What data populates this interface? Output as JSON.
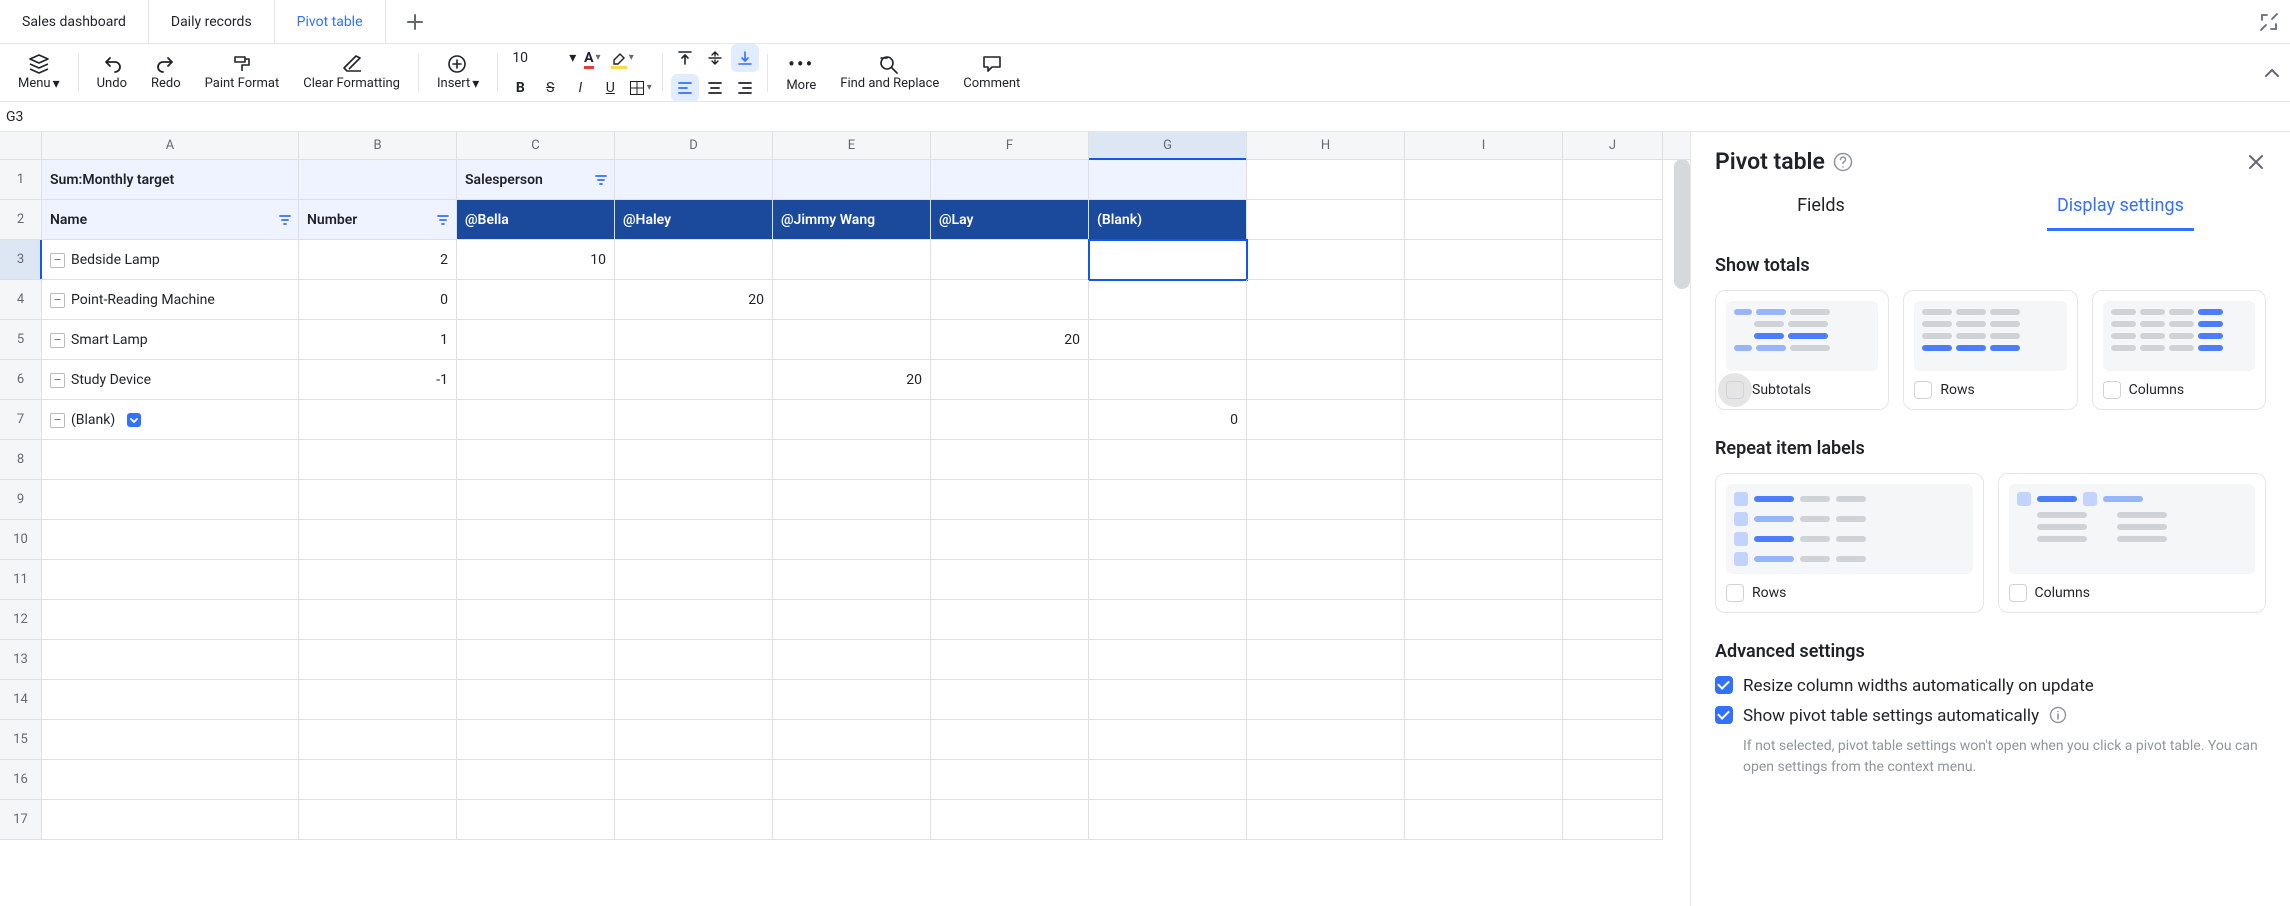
{
  "tabs": {
    "items": [
      {
        "label": "Sales dashboard"
      },
      {
        "label": "Daily records"
      },
      {
        "label": "Pivot table"
      }
    ],
    "activeIndex": 2
  },
  "toolbar": {
    "menu": "Menu",
    "undo": "Undo",
    "redo": "Redo",
    "paint_format": "Paint Format",
    "clear_formatting": "Clear Formatting",
    "insert": "Insert",
    "font_size": "10",
    "more": "More",
    "find_replace": "Find and Replace",
    "comment": "Comment"
  },
  "reference": {
    "cell": "G3"
  },
  "grid": {
    "columns": [
      "A",
      "B",
      "C",
      "D",
      "E",
      "F",
      "G",
      "H",
      "I",
      "J"
    ],
    "active_column": "G",
    "row_numbers": [
      1,
      2,
      3,
      4,
      5,
      6,
      7,
      8,
      9,
      10,
      11,
      12,
      13,
      14,
      15,
      16,
      17
    ],
    "active_row": 3,
    "r1": {
      "A": "Sum:Monthly target",
      "C": "Salesperson"
    },
    "r2": {
      "A": "Name",
      "B": "Number",
      "C": "@Bella",
      "D": "@Haley",
      "E": "@Jimmy Wang",
      "F": "@Lay",
      "G": "(Blank)"
    },
    "r3": {
      "A": "Bedside Lamp",
      "B": "2",
      "C": "10"
    },
    "r4": {
      "A": "Point-Reading Machine",
      "B": "0",
      "D": "20"
    },
    "r5": {
      "A": "Smart Lamp",
      "B": "1",
      "F": "20"
    },
    "r6": {
      "A": "Study Device",
      "B": "-1",
      "E": "20"
    },
    "r7": {
      "A": "(Blank)",
      "G": "0"
    }
  },
  "panel": {
    "title": "Pivot table",
    "tabs": {
      "fields": "Fields",
      "display": "Display settings",
      "activeIndex": 1
    },
    "show_totals": {
      "title": "Show totals",
      "subtotals": "Subtotals",
      "rows": "Rows",
      "columns": "Columns"
    },
    "repeat": {
      "title": "Repeat item labels",
      "rows": "Rows",
      "columns": "Columns"
    },
    "advanced": {
      "title": "Advanced settings",
      "resize": "Resize column widths automatically on update",
      "show_auto": "Show pivot table settings automatically",
      "hint": "If not selected, pivot table settings won't open when you click a pivot table. You can open settings from the context menu."
    }
  },
  "colors": {
    "accent": "#3370ff",
    "grid_line": "#dee0e3"
  }
}
